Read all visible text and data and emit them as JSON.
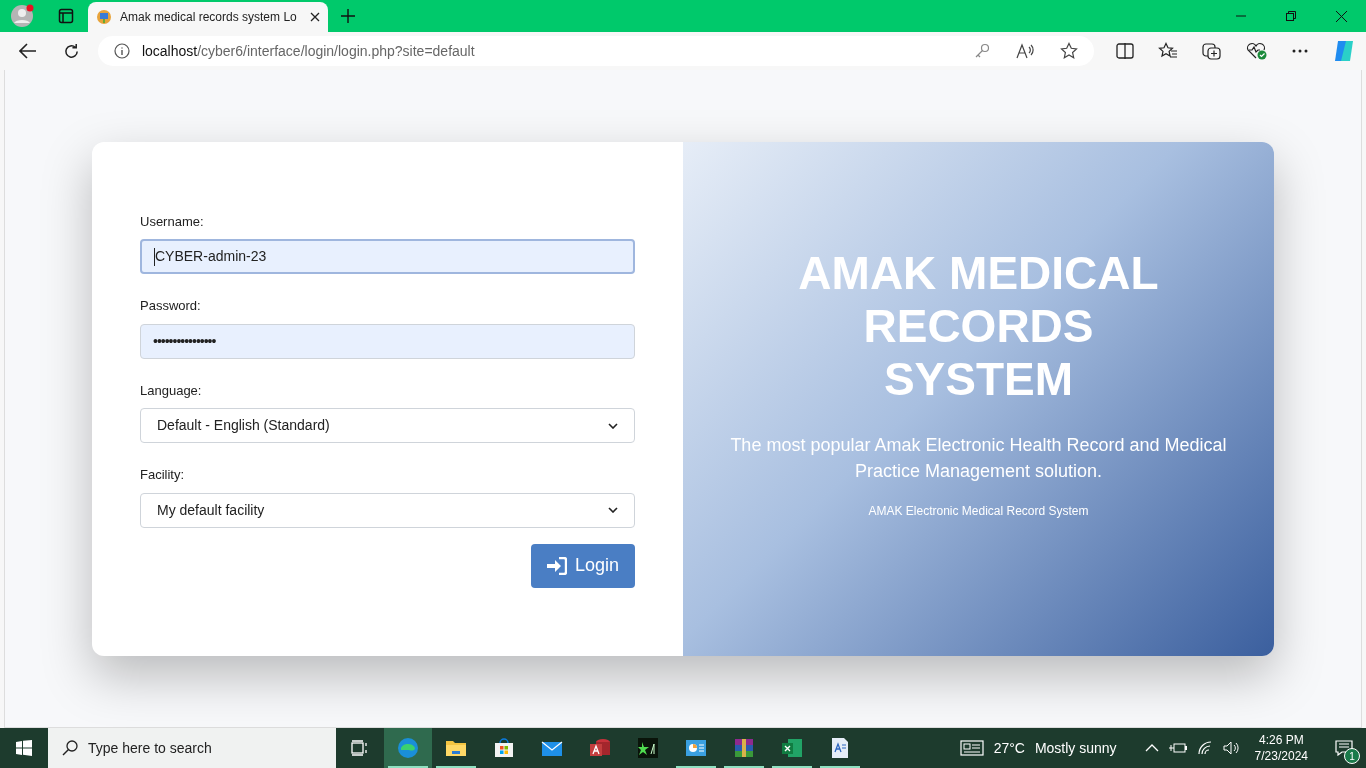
{
  "browser": {
    "tab_title": "Amak medical records system Lo",
    "url_host": "localhost",
    "url_path": "/cyber6/interface/login/login.php?site=default"
  },
  "form": {
    "fields": [
      {
        "kind": "text",
        "label": "Username:",
        "value": "CYBER-admin-23",
        "focused": true
      },
      {
        "kind": "password",
        "label": "Password:",
        "value": "••••••••••••••••",
        "focused": false
      },
      {
        "kind": "select",
        "label": "Language:",
        "value": "Default - English (Standard)",
        "focused": false
      },
      {
        "kind": "select",
        "label": "Facility:",
        "value": "My default facility",
        "focused": false
      }
    ],
    "button": "Login"
  },
  "hero": {
    "title": "AMAK MEDICAL RECORDS SYSTEM",
    "subtitle": "The most popular Amak Electronic Health Record and Medical Practice Management solution.",
    "footer": "AMAK Electronic Medical Record System"
  },
  "taskbar": {
    "search_placeholder": "Type here to search",
    "apps": [
      {
        "kind": "edge",
        "selected": true,
        "running": true
      },
      {
        "kind": "folder",
        "selected": false,
        "running": true
      },
      {
        "kind": "store",
        "selected": false,
        "running": false
      },
      {
        "kind": "mail",
        "selected": false,
        "running": false
      },
      {
        "kind": "access",
        "selected": false,
        "running": false
      },
      {
        "kind": "terminal",
        "selected": false,
        "running": false
      },
      {
        "kind": "chart",
        "selected": false,
        "running": true
      },
      {
        "kind": "archive",
        "selected": false,
        "running": true
      },
      {
        "kind": "excel",
        "selected": false,
        "running": true
      },
      {
        "kind": "document",
        "selected": false,
        "running": true
      }
    ],
    "temperature": "27°C",
    "weather": "Mostly sunny",
    "time": "4:26 PM",
    "date": "7/23/2024",
    "notifications": "1"
  }
}
